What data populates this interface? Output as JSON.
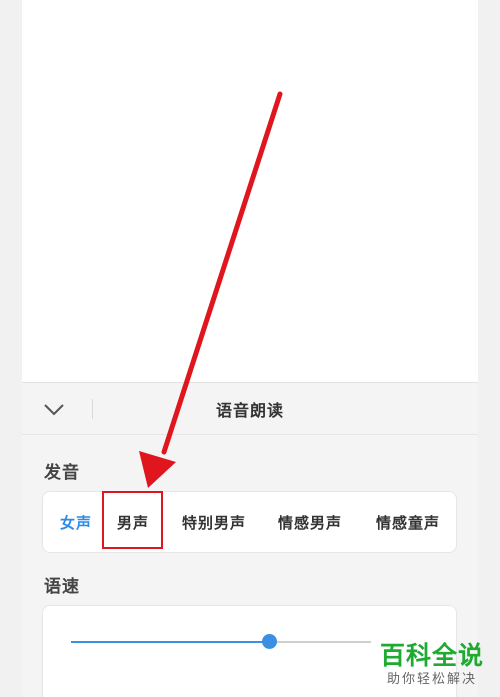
{
  "sheet": {
    "title": "语音朗读",
    "collapse_icon": "chevron-down-icon"
  },
  "voice_section": {
    "label": "发音",
    "options": [
      "女声",
      "男声",
      "特别男声",
      "情感男声",
      "情感童声"
    ],
    "selected_index": 0,
    "highlighted_index": 1
  },
  "speed_section": {
    "label": "语速",
    "slider_value_percent": 66
  },
  "annotation": {
    "arrow_color": "#e0161e",
    "box_color": "#e0161e"
  },
  "watermark": {
    "main": "百科全说",
    "sub": "助你轻松解决"
  },
  "colors": {
    "accent": "#2d8ae6",
    "watermark_green": "#1fab32"
  }
}
